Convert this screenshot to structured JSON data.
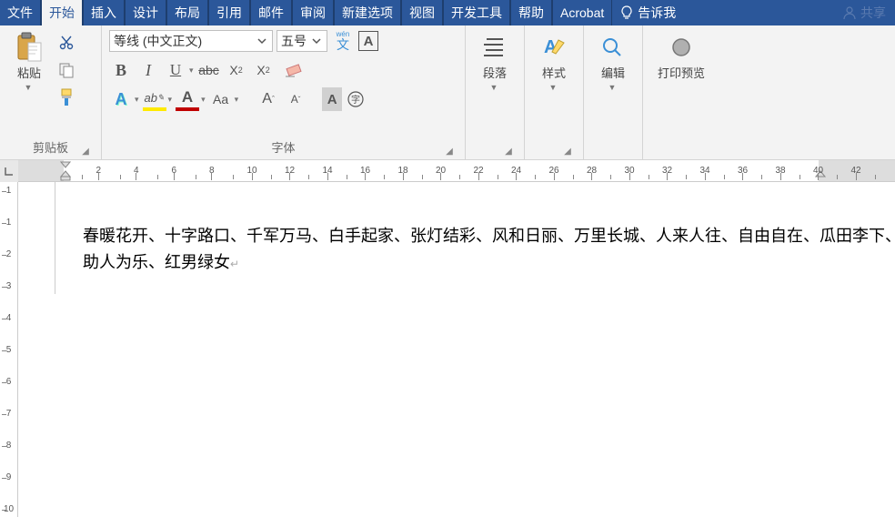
{
  "tabs": [
    "文件",
    "开始",
    "插入",
    "设计",
    "布局",
    "引用",
    "邮件",
    "审阅",
    "新建选项",
    "视图",
    "开发工具",
    "帮助",
    "Acrobat"
  ],
  "active_tab_index": 1,
  "tell_me": "告诉我",
  "share": "共享",
  "groups": {
    "clipboard": {
      "label": "剪贴板",
      "paste": "粘贴"
    },
    "font": {
      "label": "字体",
      "font_name": "等线 (中文正文)",
      "font_size": "五号",
      "wen_ruby": "wén",
      "wen_char": "文"
    },
    "paragraph": {
      "label": "段落"
    },
    "styles": {
      "label": "样式"
    },
    "editing": {
      "label": "编辑"
    },
    "print_preview": {
      "label": "打印预览"
    }
  },
  "ruler_nums": [
    2,
    4,
    6,
    8,
    10,
    12,
    14,
    16,
    18,
    20,
    22,
    24,
    26,
    28,
    30,
    32,
    34,
    36,
    38,
    40,
    42
  ],
  "vruler_nums": [
    1,
    1,
    2,
    3,
    4,
    5,
    6,
    7,
    8,
    9,
    10
  ],
  "document_text": "春暖花开、十字路口、千军万马、白手起家、张灯结彩、风和日丽、万里长城、人来人往、自由自在、瓜田李下、助人为乐、红男绿女"
}
